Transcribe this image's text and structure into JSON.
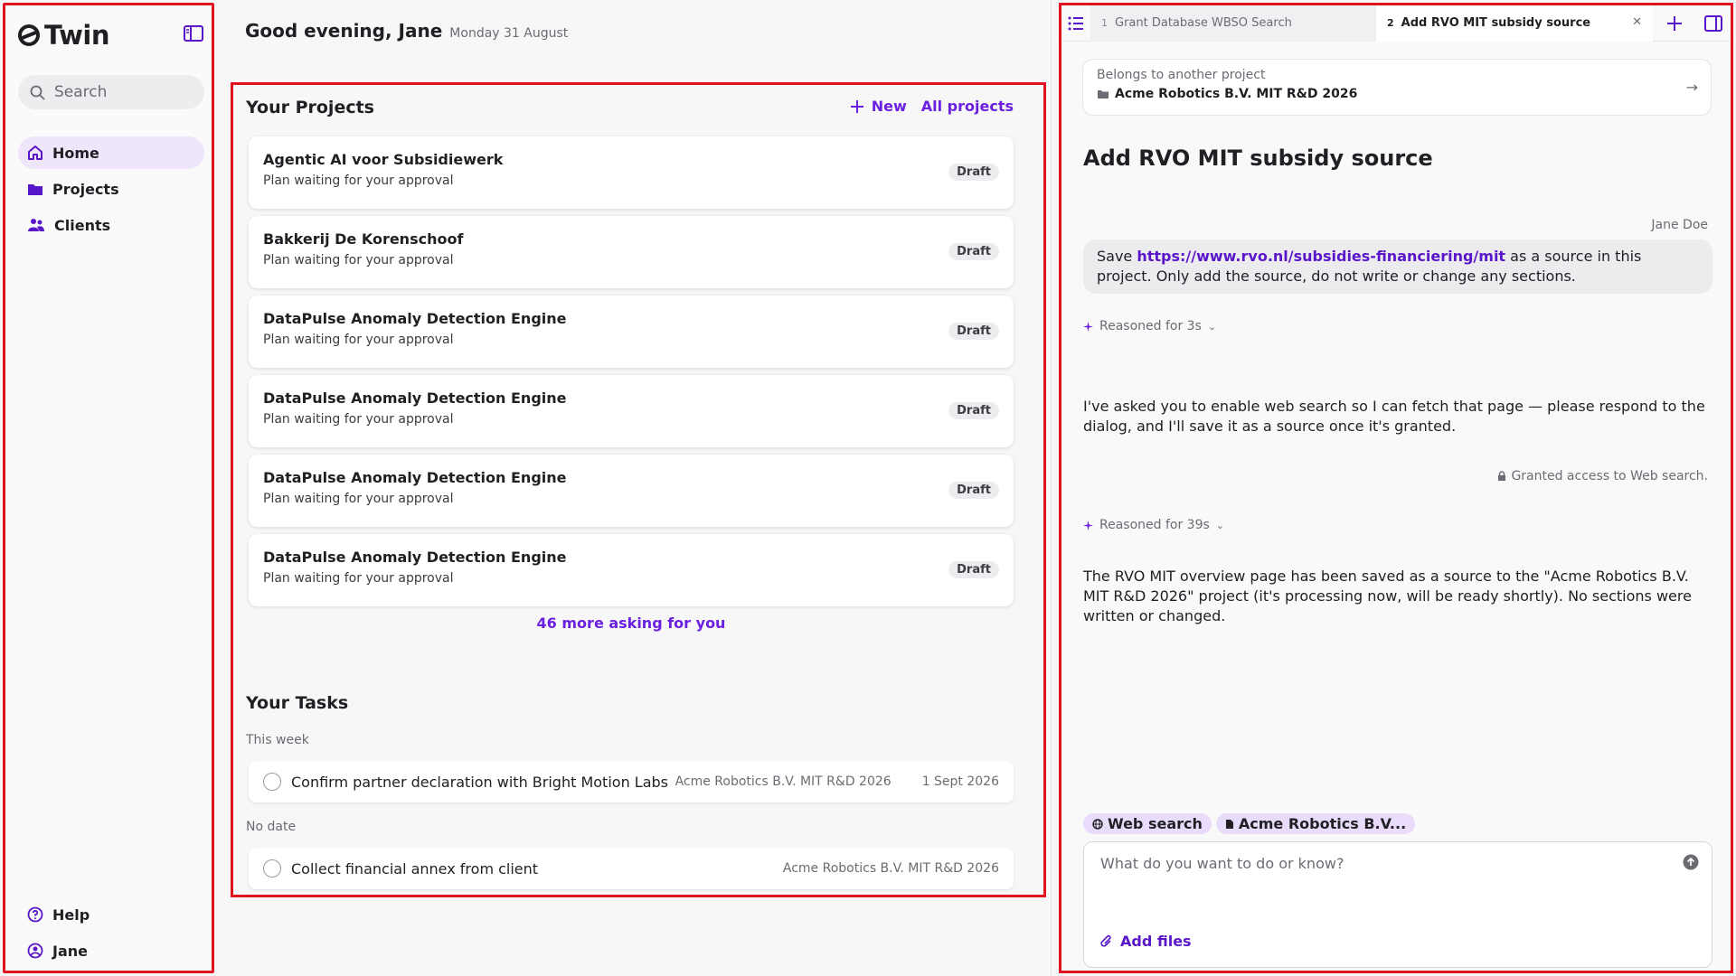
{
  "sidebar": {
    "app_name": "Twin",
    "search_placeholder": "Search",
    "items": [
      {
        "label": "Home",
        "icon": "home-icon"
      },
      {
        "label": "Projects",
        "icon": "folder-icon"
      },
      {
        "label": "Clients",
        "icon": "users-icon"
      }
    ],
    "bottom": [
      {
        "label": "Help",
        "icon": "help-icon"
      },
      {
        "label": "Jane",
        "icon": "user-icon"
      }
    ]
  },
  "header": {
    "greeting": "Good evening, Jane",
    "date": "Monday 31 August"
  },
  "projects": {
    "title": "Your Projects",
    "new_label": "New",
    "all_label": "All projects",
    "items": [
      {
        "name": "Agentic AI voor Subsidiewerk",
        "status": "Plan waiting for your approval",
        "badge": "Draft"
      },
      {
        "name": "Bakkerij De Korenschoof",
        "status": "Plan waiting for your approval",
        "badge": "Draft"
      },
      {
        "name": "DataPulse Anomaly Detection Engine",
        "status": "Plan waiting for your approval",
        "badge": "Draft"
      },
      {
        "name": "DataPulse Anomaly Detection Engine",
        "status": "Plan waiting for your approval",
        "badge": "Draft"
      },
      {
        "name": "DataPulse Anomaly Detection Engine",
        "status": "Plan waiting for your approval",
        "badge": "Draft"
      },
      {
        "name": "DataPulse Anomaly Detection Engine",
        "status": "Plan waiting for your approval",
        "badge": "Draft"
      }
    ],
    "more": "46 more asking for you"
  },
  "tasks": {
    "title": "Your Tasks",
    "groups": [
      {
        "label": "This week",
        "items": [
          {
            "name": "Confirm partner declaration with Bright Motion Labs",
            "project": "Acme Robotics B.V. MIT R&D 2026",
            "due": "1 Sept 2026"
          }
        ]
      },
      {
        "label": "No date",
        "items": [
          {
            "name": "Collect financial annex from client",
            "project": "Acme Robotics B.V. MIT R&D 2026",
            "due": ""
          }
        ]
      }
    ]
  },
  "panel": {
    "tabs": [
      {
        "num": "1",
        "label": "Grant Database WBSO Search"
      },
      {
        "num": "2",
        "label": "Add RVO MIT subsidy source"
      }
    ],
    "belongs_label": "Belongs to another project",
    "belongs_project": "Acme Robotics B.V. MIT R&D 2026",
    "title": "Add RVO MIT subsidy source",
    "user": "Jane Doe",
    "message_pre": "Save ",
    "message_link": "https://www.rvo.nl/subsidies-financiering/mit",
    "message_post": " as a source in this project. Only add the source, do not write or change any sections.",
    "reason1": "Reasoned for 3s",
    "reply1": "I've asked you to enable web search so I can fetch that page — please respond to the dialog, and I'll save it as a source once it's granted.",
    "granted": "Granted access to Web search.",
    "reason2": "Reasoned for 39s",
    "reply2": "The RVO MIT overview page has been saved as a source to the \"Acme Robotics B.V. MIT R&D 2026\" project (it's processing now, will be ready shortly). No sections were written or changed.",
    "chips": [
      "Web search",
      "Acme Robotics B.V..."
    ],
    "composer_placeholder": "What do you want to do or know?",
    "add_files": "Add files"
  },
  "colors": {
    "accent": "#6b1fe0",
    "highlight": "#e0141e",
    "active_nav": "#efe6fb"
  }
}
